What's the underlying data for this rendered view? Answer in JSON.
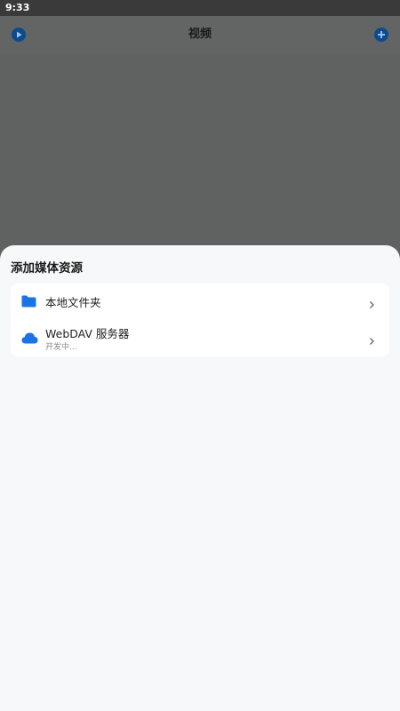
{
  "status_bar": {
    "time": "9:33"
  },
  "top_bar": {
    "title": "视频"
  },
  "sheet": {
    "title": "添加媒体资源",
    "items": [
      {
        "label": "本地文件夹",
        "icon": "folder-icon"
      },
      {
        "label": "WebDAV 服务器",
        "subtitle": "开发中...",
        "icon": "cloud-icon"
      }
    ]
  },
  "colors": {
    "accent": "#1a73e8",
    "header_icon_bg": "#0e4b8e",
    "overlay": "#626564",
    "sheet_bg": "#f7f8fa"
  }
}
